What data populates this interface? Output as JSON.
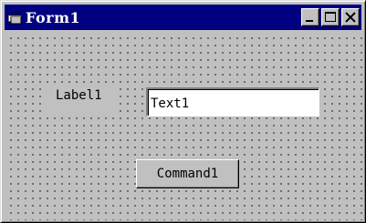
{
  "window": {
    "title": "Form1",
    "title_bar_color": "#000080",
    "title_text_color": "#ffffff",
    "face_color": "#c0c0c0",
    "buttons": [
      "minimize",
      "maximize",
      "close"
    ]
  },
  "form": {
    "label_text": "Label1",
    "textbox_value": "Text1",
    "command_label": "Command1",
    "grid": "dotted design grid"
  },
  "icons": {
    "app": "form-icon",
    "minimize": "minimize-icon",
    "maximize": "maximize-icon",
    "close": "close-icon"
  }
}
